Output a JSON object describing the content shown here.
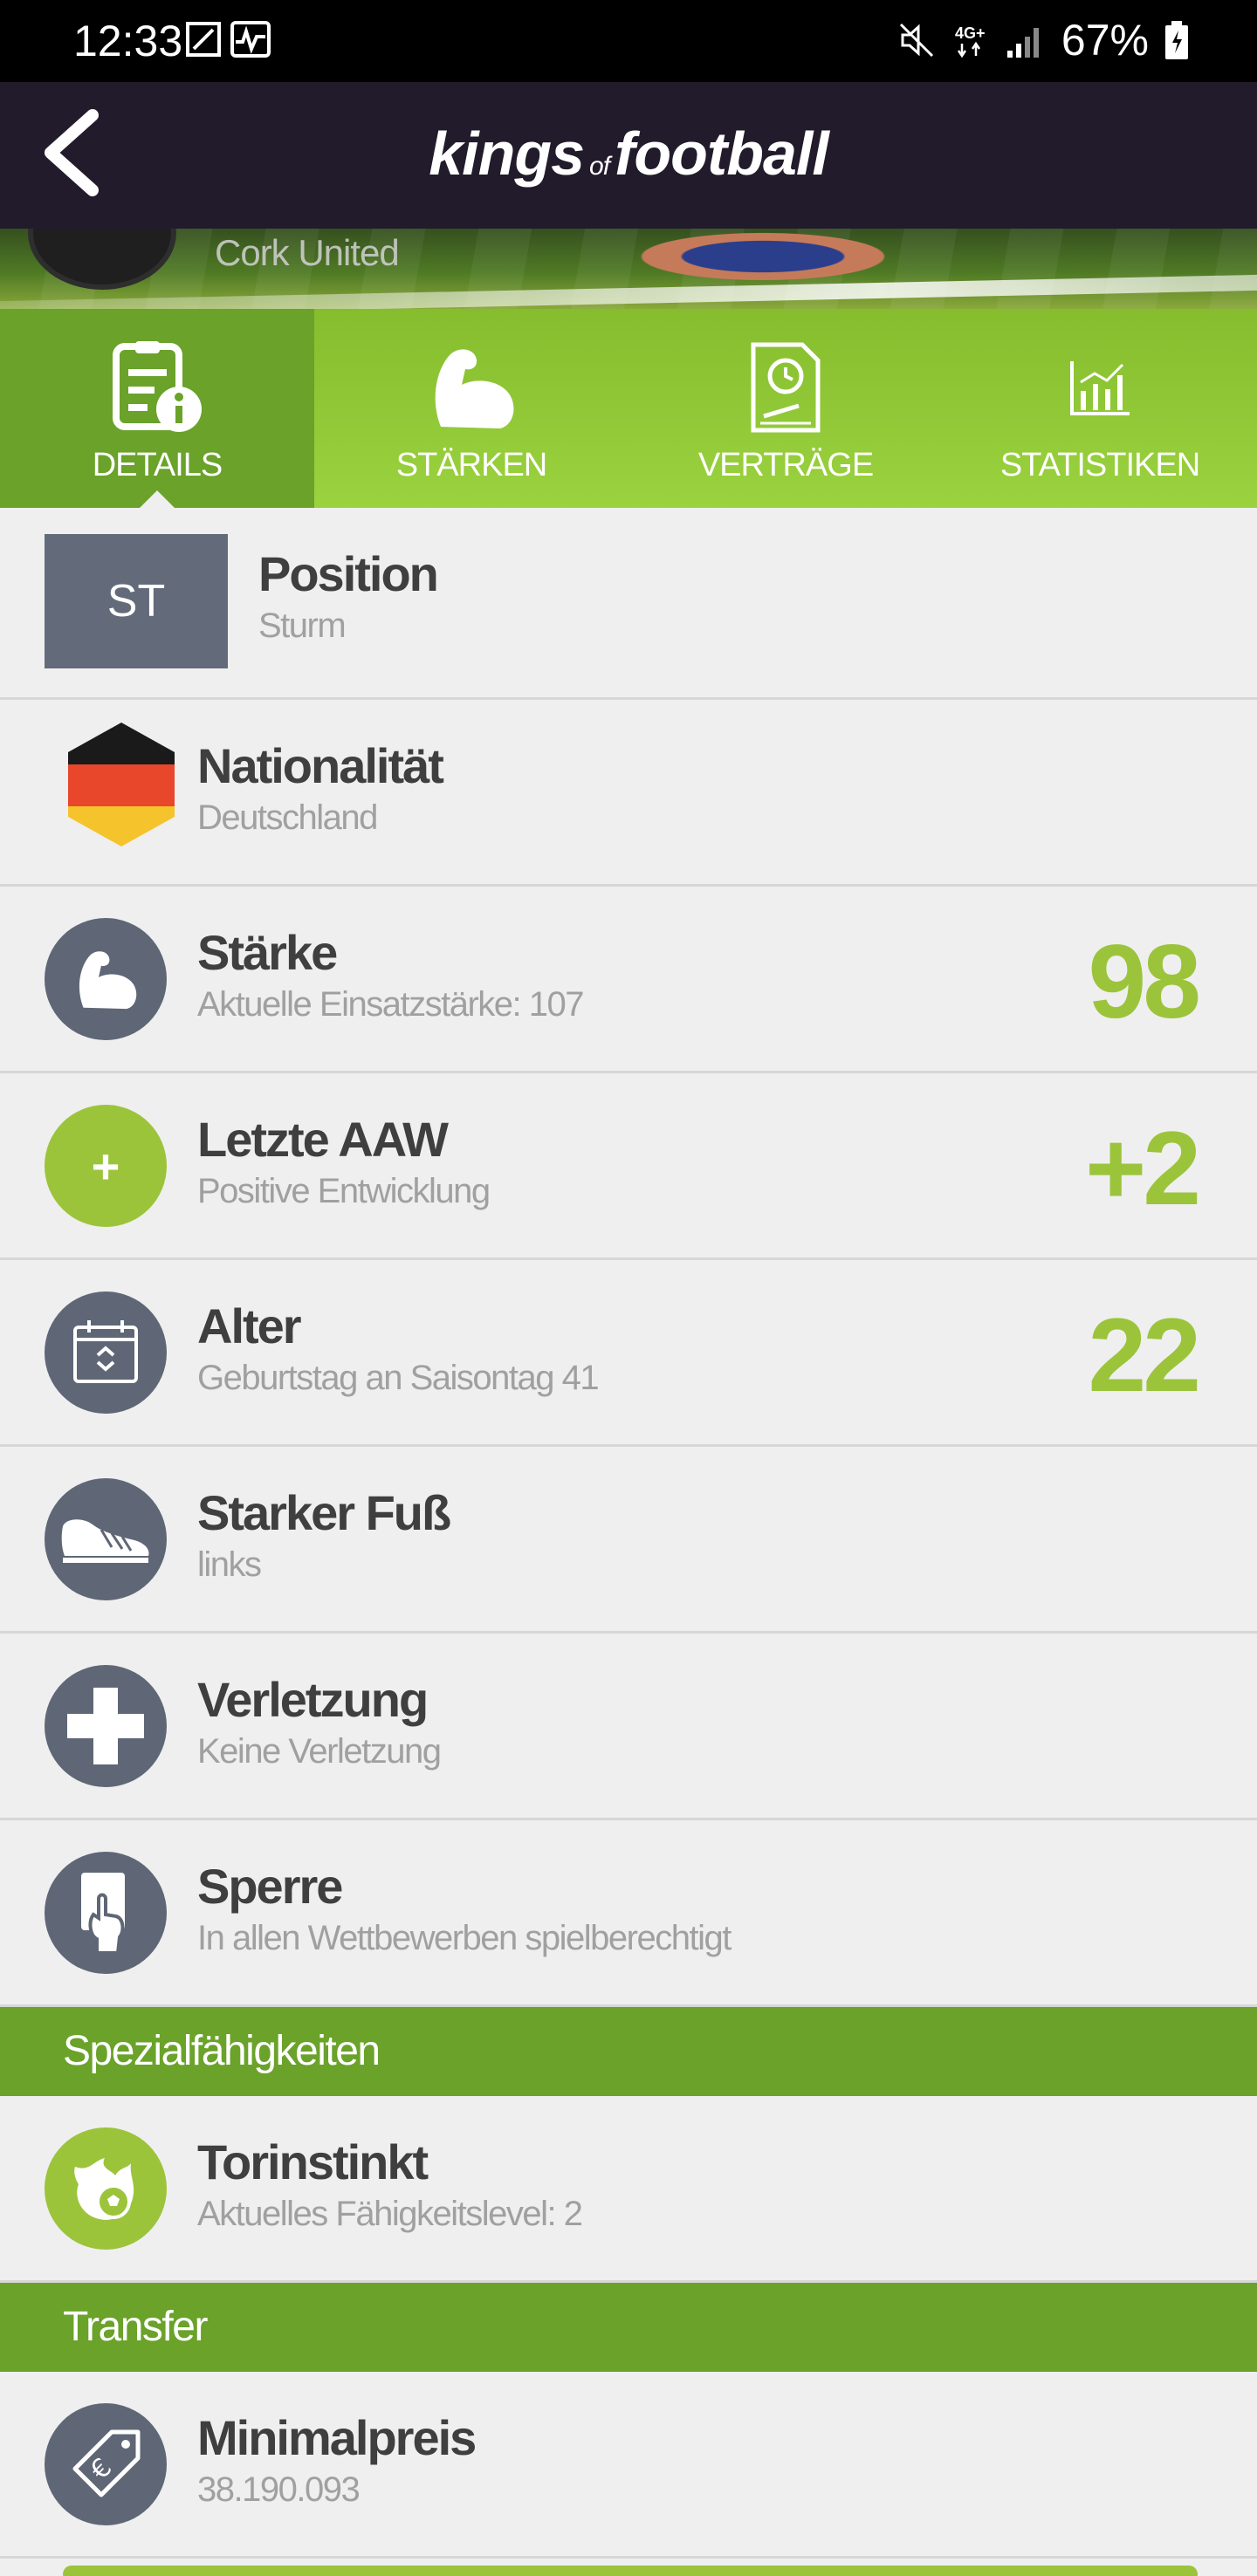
{
  "status_bar": {
    "time": "12:33",
    "battery": "67%",
    "icons": [
      "screenshot-icon",
      "activity-icon",
      "mute-icon",
      "4g-icon",
      "signal-icon",
      "battery-icon"
    ]
  },
  "header": {
    "logo_part1": "kings",
    "logo_part2": "of",
    "logo_part3": "football"
  },
  "hero": {
    "club": "Cork United"
  },
  "tabs": [
    {
      "label": "DETAILS",
      "active": true,
      "icon": "details-icon"
    },
    {
      "label": "STÄRKEN",
      "active": false,
      "icon": "muscle-icon"
    },
    {
      "label": "VERTRÄGE",
      "active": false,
      "icon": "contract-icon"
    },
    {
      "label": "STATISTIKEN",
      "active": false,
      "icon": "stats-icon"
    }
  ],
  "details": {
    "position": {
      "badge": "ST",
      "title": "Position",
      "sub": "Sturm"
    },
    "nationality": {
      "title": "Nationalität",
      "sub": "Deutschland",
      "flag_colors": [
        "#1a1a1a",
        "#e8472b",
        "#f5c32b"
      ]
    },
    "strength": {
      "title": "Stärke",
      "sub": "Aktuelle Einsatzstärke: 107",
      "value": "98"
    },
    "last_aaw": {
      "title": "Letzte AAW",
      "sub": "Positive Entwicklung",
      "value": "+2",
      "icon_symbol": "+"
    },
    "age": {
      "title": "Alter",
      "sub": "Geburtstag an Saisontag 41",
      "value": "22"
    },
    "foot": {
      "title": "Starker Fuß",
      "sub": "links"
    },
    "injury": {
      "title": "Verletzung",
      "sub": "Keine Verletzung"
    },
    "ban": {
      "title": "Sperre",
      "sub": "In allen Wettbewerben spielberechtigt"
    }
  },
  "special": {
    "header": "Spezialfähigkeiten",
    "skill": {
      "title": "Torinstinkt",
      "sub": "Aktuelles Fähigkeitslevel: 2"
    }
  },
  "transfer": {
    "header": "Transfer",
    "min_price": {
      "title": "Minimalpreis",
      "sub": "38.190.093"
    }
  },
  "colors": {
    "accent_green": "#9bc43b",
    "dark_green": "#6aa22a",
    "header_dark": "#221b2b",
    "icon_grey": "#5f6776"
  }
}
